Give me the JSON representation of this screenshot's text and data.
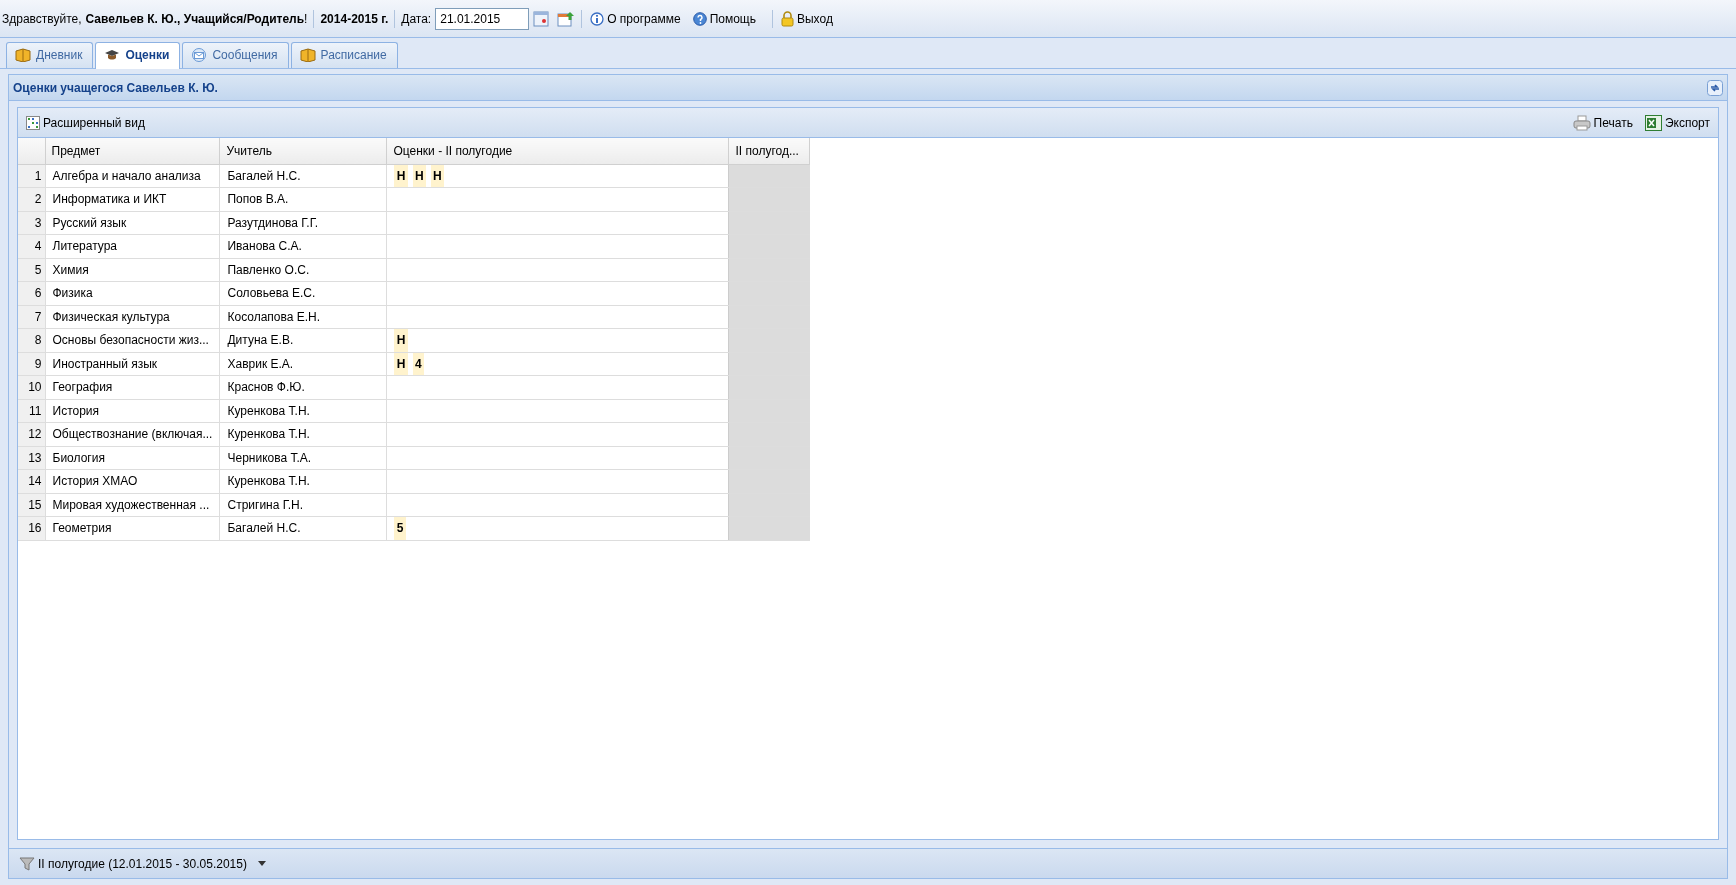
{
  "topbar": {
    "greeting": "Здравствуйте,",
    "user": "Савельев К. Ю., Учащийся/Родитель",
    "exclaim": "!",
    "year": "2014-2015 г.",
    "date_label": "Дата:",
    "date_value": "21.01.2015",
    "links": [
      "О программе",
      "Помощь",
      "Выход"
    ]
  },
  "tabs": [
    {
      "label": "Дневник",
      "selected": false
    },
    {
      "label": "Оценки",
      "selected": true
    },
    {
      "label": "Сообщения",
      "selected": false
    },
    {
      "label": "Расписание",
      "selected": false
    }
  ],
  "panel": {
    "title": "Оценки учащегося Савельев К. Ю.",
    "toolbar": {
      "view_button": "Расширенный вид",
      "print_button": "Печать",
      "export_button": "Экспорт"
    }
  },
  "table": {
    "columns": [
      "Предмет",
      "Учитель",
      "Оценки - II полугодие",
      "II полугод..."
    ],
    "rows": [
      {
        "n": "1",
        "subject": "Алгебра и начало анализа",
        "teacher": "Багалей Н.С.",
        "marks": [
          "Н",
          "Н",
          "Н"
        ]
      },
      {
        "n": "2",
        "subject": "Информатика и ИКТ",
        "teacher": "Попов В.А.",
        "marks": []
      },
      {
        "n": "3",
        "subject": "Русский язык",
        "teacher": "Разутдинова Г.Г.",
        "marks": []
      },
      {
        "n": "4",
        "subject": "Литература",
        "teacher": "Иванова С.А.",
        "marks": []
      },
      {
        "n": "5",
        "subject": "Химия",
        "teacher": "Павленко О.С.",
        "marks": []
      },
      {
        "n": "6",
        "subject": "Физика",
        "teacher": "Соловьева Е.С.",
        "marks": []
      },
      {
        "n": "7",
        "subject": "Физическая культура",
        "teacher": "Косолапова Е.Н.",
        "marks": []
      },
      {
        "n": "8",
        "subject": "Основы безопасности жиз...",
        "teacher": "Дитуна Е.В.",
        "marks": [
          "Н"
        ]
      },
      {
        "n": "9",
        "subject": "Иностранный язык",
        "teacher": "Хаврик Е.А.",
        "marks": [
          "Н",
          "4"
        ]
      },
      {
        "n": "10",
        "subject": "География",
        "teacher": "Краснов Ф.Ю.",
        "marks": []
      },
      {
        "n": "11",
        "subject": "История",
        "teacher": "Куренкова Т.Н.",
        "marks": []
      },
      {
        "n": "12",
        "subject": "Обществознание (включая...",
        "teacher": "Куренкова Т.Н.",
        "marks": []
      },
      {
        "n": "13",
        "subject": "Биология",
        "teacher": "Черникова Т.А.",
        "marks": []
      },
      {
        "n": "14",
        "subject": "История ХМАО",
        "teacher": "Куренкова Т.Н.",
        "marks": []
      },
      {
        "n": "15",
        "subject": "Мировая художественная ...",
        "teacher": "Стригина Г.Н.",
        "marks": []
      },
      {
        "n": "16",
        "subject": "Геометрия",
        "teacher": "Багалей Н.С.",
        "marks": [
          "5"
        ]
      }
    ]
  },
  "period_filter": "II полугодие (12.01.2015 - 30.05.2015)"
}
